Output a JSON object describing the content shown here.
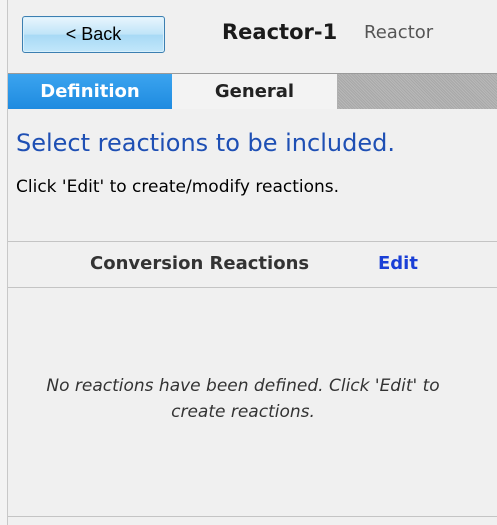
{
  "header": {
    "back_label": "< Back",
    "title": "Reactor-1",
    "type": "Reactor"
  },
  "tabs": [
    {
      "label": "Definition",
      "active": true
    },
    {
      "label": "General",
      "active": false
    }
  ],
  "instructions": {
    "title": "Select reactions to be included.",
    "subtitle": "Click 'Edit' to create/modify reactions."
  },
  "section": {
    "title": "Conversion Reactions",
    "edit_label": "Edit"
  },
  "empty_message": "No reactions have been defined. Click 'Edit' to create reactions.",
  "colors": {
    "active_tab": "#2596e8",
    "instruction_title": "#1e4fb4",
    "edit_link": "#1a3fd6"
  }
}
